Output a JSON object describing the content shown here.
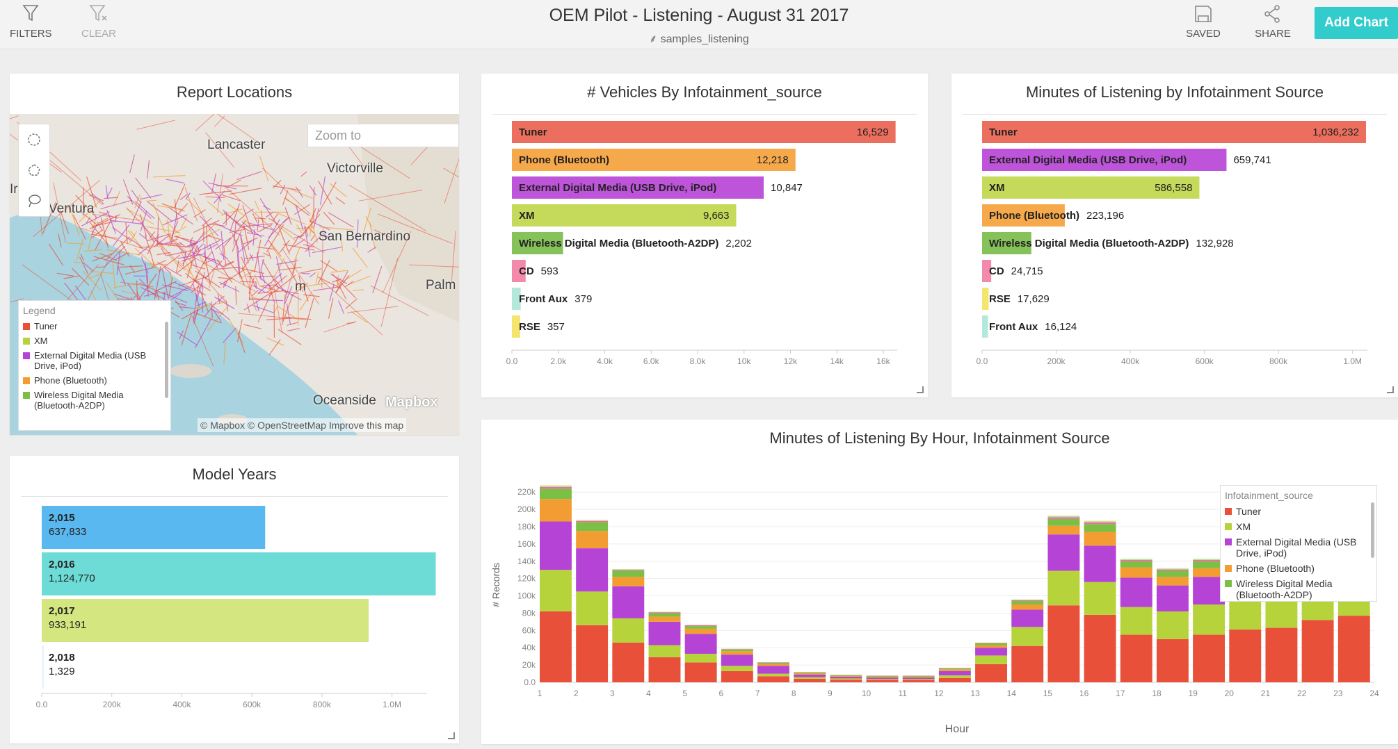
{
  "toolbar": {
    "filters_label": "FILTERS",
    "clear_label": "CLEAR",
    "title": "OEM Pilot - Listening - August 31 2017",
    "subtitle": "⸙ samples_listening",
    "saved_label": "SAVED",
    "share_label": "SHARE",
    "add_chart_label": "Add Chart"
  },
  "colors": {
    "accent": "#33cccc",
    "tuner": "#e8503a",
    "phone": "#f39c32",
    "external": "#b543d6",
    "xm": "#b7d33c",
    "wireless": "#7bbf44",
    "cd": "#f06c9b",
    "front_aux": "#9be2d0",
    "rse": "#f2e25f"
  },
  "map_panel": {
    "title": "Report Locations",
    "zoom_placeholder": "Zoom to",
    "cities": [
      "Lancaster",
      "Victorville",
      "Ventura",
      "San Bernardino",
      "Palm",
      "Oceanside",
      "Ira",
      "m"
    ],
    "attribution": "© Mapbox  © OpenStreetMap  Improve this map",
    "logo": "Mapbox",
    "legend": {
      "title": "Legend",
      "items": [
        {
          "label": "Tuner",
          "color": "#e8503a"
        },
        {
          "label": "XM",
          "color": "#b7d33c"
        },
        {
          "label": "External Digital Media (USB Drive, iPod)",
          "color": "#b543d6"
        },
        {
          "label": "Phone (Bluetooth)",
          "color": "#f39c32"
        },
        {
          "label": "Wireless Digital Media (Bluetooth-A2DP)",
          "color": "#7bbf44"
        }
      ]
    }
  },
  "model_years_panel": {
    "title": "Model Years"
  },
  "vehicles_panel": {
    "title": "# Vehicles By Infotainment_source"
  },
  "minutes_panel": {
    "title": "Minutes of Listening by Infotainment Source"
  },
  "hour_panel": {
    "title": "Minutes of Listening By Hour, Infotainment Source"
  },
  "chart_data": [
    {
      "type": "bar",
      "orientation": "horizontal",
      "title": "Model Years",
      "categories": [
        "2,015",
        "2,016",
        "2,017",
        "2,018"
      ],
      "values": [
        637833,
        1124770,
        933191,
        1329
      ],
      "value_labels": [
        "637,833",
        "1,124,770",
        "933,191",
        "1,329"
      ],
      "colors": [
        "#5ab8f0",
        "#6ddcd6",
        "#d4e67f",
        "#e8f3fb"
      ],
      "xlim": [
        0,
        1100000
      ],
      "xticks": [
        0,
        200000,
        400000,
        600000,
        800000,
        1000000
      ],
      "xtick_labels": [
        "0.0",
        "200k",
        "400k",
        "600k",
        "800k",
        "1.0M"
      ]
    },
    {
      "type": "bar",
      "orientation": "horizontal",
      "title": "# Vehicles By Infotainment_source",
      "categories": [
        "Tuner",
        "Phone (Bluetooth)",
        "External Digital Media (USB Drive, iPod)",
        "XM",
        "Wireless Digital Media (Bluetooth-A2DP)",
        "CD",
        "Front Aux",
        "RSE"
      ],
      "values": [
        16529,
        12218,
        10847,
        9663,
        2202,
        593,
        379,
        357
      ],
      "value_labels": [
        "16,529",
        "12,218",
        "10,847",
        "9,663",
        "2,202",
        "593",
        "379",
        "357"
      ],
      "colors": [
        "#ec6e5e",
        "#f5a94a",
        "#bd54d9",
        "#c5d95a",
        "#85c25a",
        "#f48aab",
        "#b3e8da",
        "#f4e56f"
      ],
      "xlim": [
        0,
        16600
      ],
      "xticks": [
        0,
        2000,
        4000,
        6000,
        8000,
        10000,
        12000,
        14000,
        16000
      ],
      "xtick_labels": [
        "0.0",
        "2.0k",
        "4.0k",
        "6.0k",
        "8.0k",
        "10k",
        "12k",
        "14k",
        "16k"
      ]
    },
    {
      "type": "bar",
      "orientation": "horizontal",
      "title": "Minutes of Listening by Infotainment Source",
      "categories": [
        "Tuner",
        "External Digital Media (USB Drive, iPod)",
        "XM",
        "Phone (Bluetooth)",
        "Wireless Digital Media (Bluetooth-A2DP)",
        "CD",
        "RSE",
        "Front Aux"
      ],
      "values": [
        1036232,
        659741,
        586558,
        223196,
        132928,
        24715,
        17629,
        16124
      ],
      "value_labels": [
        "1,036,232",
        "659,741",
        "586,558",
        "223,196",
        "132,928",
        "24,715",
        "17,629",
        "16,124"
      ],
      "colors": [
        "#ec6e5e",
        "#bd54d9",
        "#c5d95a",
        "#f5a94a",
        "#85c25a",
        "#f48aab",
        "#f4e56f",
        "#b3e8da"
      ],
      "xlim": [
        0,
        1040000
      ],
      "xticks": [
        0,
        200000,
        400000,
        600000,
        800000,
        1000000
      ],
      "xtick_labels": [
        "0.0",
        "200k",
        "400k",
        "600k",
        "800k",
        "1.0M"
      ]
    },
    {
      "type": "bar",
      "stacked": true,
      "title": "Minutes of Listening By Hour, Infotainment Source",
      "xlabel": "Hour",
      "ylabel": "# Records",
      "x": [
        1,
        2,
        3,
        4,
        5,
        6,
        7,
        8,
        9,
        10,
        11,
        12,
        13,
        14,
        15,
        16,
        17,
        18,
        19,
        20,
        21,
        22,
        23
      ],
      "xlim": [
        1,
        24
      ],
      "xticks": [
        1,
        2,
        3,
        4,
        5,
        6,
        7,
        8,
        9,
        10,
        11,
        12,
        13,
        14,
        15,
        16,
        17,
        18,
        19,
        20,
        21,
        22,
        23,
        24
      ],
      "ylim": [
        0,
        225000
      ],
      "yticks": [
        0,
        20000,
        40000,
        60000,
        80000,
        100000,
        120000,
        140000,
        160000,
        180000,
        200000,
        220000
      ],
      "ytick_labels": [
        "0.0",
        "20k",
        "40k",
        "60k",
        "80k",
        "100k",
        "120k",
        "140k",
        "160k",
        "180k",
        "200k",
        "220k"
      ],
      "legend_title": "Infotainment_source",
      "legend_position": "top-right",
      "series": [
        {
          "name": "Tuner",
          "color": "#e8503a",
          "values": [
            82000,
            66000,
            46000,
            29000,
            23000,
            13000,
            7000,
            4000,
            3000,
            3000,
            3000,
            5000,
            21000,
            42000,
            89000,
            78000,
            55000,
            50000,
            55000,
            61000,
            63000,
            72000,
            77000
          ]
        },
        {
          "name": "XM",
          "color": "#b7d33c",
          "values": [
            48000,
            39000,
            28000,
            14000,
            10000,
            6000,
            3000,
            2000,
            1500,
            1000,
            1000,
            3000,
            10000,
            22000,
            40000,
            38000,
            32000,
            32000,
            35000,
            34000,
            35000,
            38000,
            40000
          ]
        },
        {
          "name": "External Digital Media (USB Drive, iPod)",
          "color": "#b543d6",
          "values": [
            56000,
            50000,
            37000,
            27000,
            23000,
            13000,
            9000,
            3000,
            2000,
            1500,
            1500,
            5000,
            9000,
            20000,
            42000,
            42000,
            34000,
            30000,
            32000,
            32000,
            35000,
            38000,
            40000
          ]
        },
        {
          "name": "Phone (Bluetooth)",
          "color": "#f39c32",
          "values": [
            26000,
            20000,
            11000,
            6000,
            6000,
            4000,
            2000,
            1500,
            1000,
            1000,
            1000,
            2000,
            3000,
            6000,
            10000,
            16000,
            12000,
            10000,
            10000,
            10000,
            10000,
            12000,
            12000
          ]
        },
        {
          "name": "Wireless Digital Media (Bluetooth-A2DP)",
          "color": "#7bbf44",
          "values": [
            12000,
            10000,
            7000,
            4000,
            3000,
            2000,
            1500,
            1000,
            800,
            800,
            800,
            1200,
            2000,
            4000,
            8000,
            9000,
            7000,
            7000,
            8000,
            8000,
            8000,
            9000,
            9000
          ]
        },
        {
          "name": "CD",
          "color": "#f06c9b",
          "values": [
            2000,
            1500,
            1000,
            1000,
            1000,
            500,
            500,
            300,
            300,
            300,
            300,
            300,
            500,
            1000,
            2000,
            2000,
            1500,
            1500,
            1500,
            1500,
            1500,
            1500,
            1500
          ]
        },
        {
          "name": "Front Aux",
          "color": "#9be2d0",
          "values": [
            1000,
            800,
            600,
            400,
            400,
            300,
            200,
            200,
            200,
            200,
            200,
            200,
            300,
            500,
            1000,
            1000,
            800,
            800,
            800,
            800,
            800,
            800,
            800
          ]
        },
        {
          "name": "RSE",
          "color": "#f2e25f",
          "values": [
            800,
            600,
            400,
            300,
            300,
            200,
            200,
            100,
            100,
            100,
            100,
            200,
            200,
            400,
            800,
            800,
            600,
            600,
            600,
            600,
            600,
            600,
            600
          ]
        }
      ]
    }
  ]
}
